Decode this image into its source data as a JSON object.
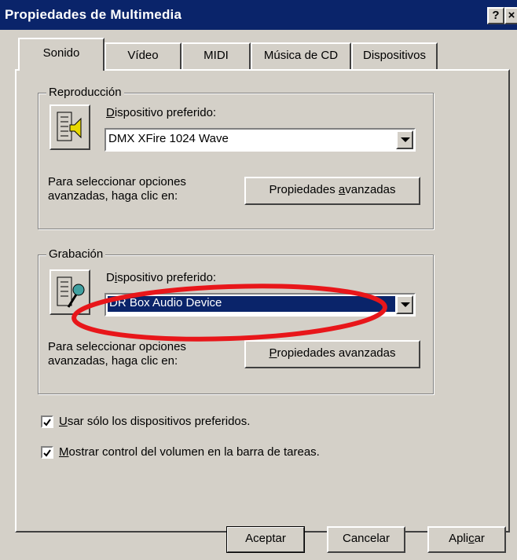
{
  "window": {
    "title": "Propiedades de Multimedia",
    "help_button": "?",
    "close_button": "×"
  },
  "tabs": [
    {
      "label": "Sonido",
      "active": true
    },
    {
      "label": "Vídeo",
      "active": false
    },
    {
      "label": "MIDI",
      "active": false
    },
    {
      "label": "Música de CD",
      "active": false
    },
    {
      "label": "Dispositivos",
      "active": false
    }
  ],
  "playback": {
    "legend": "Reproducción",
    "device_label_pre": "",
    "device_label_u": "D",
    "device_label_post": "ispositivo preferido:",
    "device_value": "DMX XFire 1024 Wave",
    "advanced_text_1": "Para seleccionar opciones",
    "advanced_text_2": "avanzadas, haga clic en:",
    "advanced_button_pre": "Propiedades ",
    "advanced_button_u": "a",
    "advanced_button_post": "vanzadas"
  },
  "recording": {
    "legend": "Grabación",
    "device_label_pre": "D",
    "device_label_u": "i",
    "device_label_post": "spositivo preferido:",
    "device_value": "DR Box Audio Device",
    "advanced_text_1": "Para seleccionar opciones",
    "advanced_text_2": "avanzadas, haga clic en:",
    "advanced_button_pre": "",
    "advanced_button_u": "P",
    "advanced_button_post": "ropiedades avanzadas"
  },
  "options": {
    "preferred_only_u": "U",
    "preferred_only_post": "sar sólo los dispositivos preferidos.",
    "preferred_only_checked": true,
    "show_volume_u": "M",
    "show_volume_post": "ostrar control del volumen en la barra de tareas.",
    "show_volume_checked": true
  },
  "footer": {
    "ok": "Aceptar",
    "cancel": "Cancelar",
    "apply_pre": "Apli",
    "apply_u": "c",
    "apply_post": "ar"
  },
  "annotation": {
    "color": "#e8161a"
  },
  "colors": {
    "titlebar": "#0a246a",
    "face": "#d4d0c8",
    "selection": "#0a246a"
  }
}
